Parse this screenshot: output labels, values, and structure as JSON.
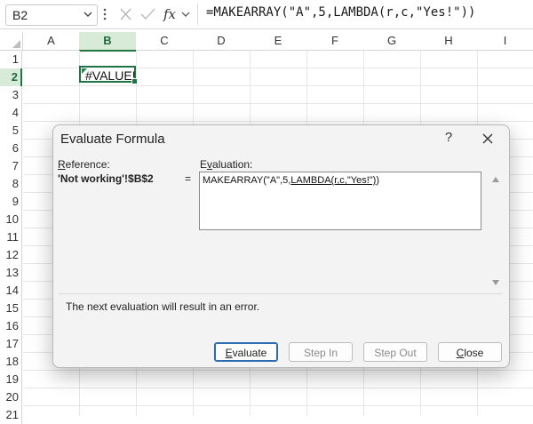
{
  "formula_bar": {
    "name_box": "B2",
    "fx_label": "fx",
    "formula": "=MAKEARRAY(\"A\",5,LAMBDA(r,c,\"Yes!\"))"
  },
  "grid": {
    "columns": [
      "A",
      "B",
      "C",
      "D",
      "E",
      "F",
      "G",
      "H",
      "I"
    ],
    "rows": [
      "1",
      "2",
      "3",
      "4",
      "5",
      "6",
      "7",
      "8",
      "9",
      "10",
      "11",
      "12",
      "13",
      "14",
      "15",
      "16",
      "17",
      "18",
      "19",
      "20",
      "21"
    ],
    "active_cell_value": "#VALUE!",
    "selected_column": "B",
    "selected_row": "2"
  },
  "dialog": {
    "title": "Evaluate Formula",
    "help": "?",
    "reference_label": "Reference:",
    "reference_label_u": "R",
    "reference_label_rest": "eference:",
    "evaluation_label_pre": "E",
    "evaluation_label_u": "v",
    "evaluation_label_rest": "aluation:",
    "reference_value": "'Not working'!$B$2",
    "equals": "=",
    "evaluation_pre": "MAKEARRAY(\"A\",5,",
    "evaluation_underlined": "LAMBDA(r,c,\"Yes!\")",
    "evaluation_post": ")",
    "status_message": "The next evaluation will result in an error.",
    "buttons": {
      "evaluate_u": "E",
      "evaluate_rest": "valuate",
      "step_in": "Step In",
      "step_out": "Step Out",
      "close_u": "C",
      "close_rest": "lose"
    }
  },
  "colors": {
    "excel_green": "#217346",
    "selection_header": "#d8ebd9",
    "dialog_bg": "#f3f3f3",
    "primary_button_border": "#2b6cb0"
  }
}
